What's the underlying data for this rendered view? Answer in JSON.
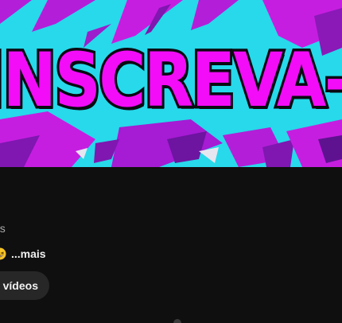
{
  "banner": {
    "text": "INSCREVA-SE"
  },
  "channel": {
    "stats_fragment": "os",
    "description_emoji": "grinning-squint-emoji",
    "more_label": "...mais",
    "videos_button_label": "r vídeos"
  },
  "colors": {
    "background": "#0f0f0f",
    "banner_cyan": "#27d9ea",
    "banner_magenta": "#f30cf7",
    "chip_background": "#272727",
    "secondary_text": "#aaaaaa"
  }
}
